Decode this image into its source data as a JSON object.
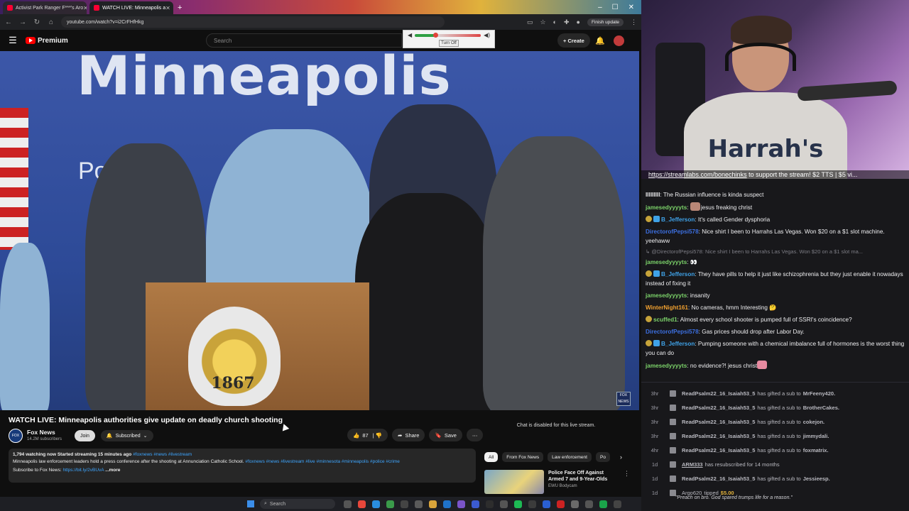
{
  "browser": {
    "tabs": [
      {
        "label": "Activist Park Ranger F***'s Aro",
        "active": false
      },
      {
        "label": "WATCH LIVE: Minneapolis a",
        "active": true
      }
    ],
    "url": "youtube.com/watch?v=i2CrFHfHkg",
    "finish_update": "Finish update"
  },
  "youtube": {
    "brand": "Premium",
    "search_placeholder": "Search",
    "create_label": "Create"
  },
  "volume_popup": {
    "turn_off_label": "Turn Off",
    "level": 0.3
  },
  "video": {
    "backdrop_word": "Minneapolis",
    "backdrop_sub": "Police",
    "seal_text": "1867",
    "seal_name": "MINNEAPOLIS",
    "seal_motto": "Serving Since",
    "network_bug": "FOX NEWS"
  },
  "watch": {
    "title": "WATCH LIVE: Minneapolis authorities give update on deadly church shooting",
    "channel_name": "Fox News",
    "channel_subs": "14.2M subscribers",
    "join_label": "Join",
    "subscribed_label": "Subscribed",
    "like_count": "87",
    "share_label": "Share",
    "save_label": "Save",
    "desc_stats": "1,794 watching now  Started streaming 15 minutes ago",
    "desc_hashtags_top": "#foxnews #news #livestream",
    "desc_line": "Minneapolis law enforcement leaders hold a press conference after the shooting at Annunciation Catholic School.",
    "desc_hashtags_line": "#foxnews #news #livestream #live #minnesota #minneapolis #police #crime",
    "desc_subscribe": "Subscribe to Fox News:",
    "desc_subscribe_link": "https://bit.ly/2vBUvA",
    "desc_more": "...more",
    "chat_disabled": "Chat is disabled for this live stream.",
    "chips": [
      "All",
      "From Fox News",
      "Law enforcement",
      "Po"
    ],
    "rec_title": "Police Face Off Against Armed 7 and 9-Year-Olds",
    "rec_channel": "EWU Bodycam"
  },
  "webcam": {
    "shirt_logo": "Harrah's",
    "ticker": "https://streamlabs.com/bonechinks",
    "ticker_rest": " to support the stream! $2 TTS | $5 vi..."
  },
  "chat": [
    {
      "user": "lllllllll",
      "color": "#efeff1",
      "badge": "",
      "emote": false,
      "text": "The Russian influence is kinda suspect"
    },
    {
      "user": "jamesedyyyyts",
      "color": "#7cd36a",
      "badge": "",
      "emote": true,
      "text": "jesus freaking christ"
    },
    {
      "user": "B_Jefferson",
      "color": "#3fa2e8",
      "badge": "gold-blue",
      "emote": false,
      "text": "It's called Gender dysphoria"
    },
    {
      "user": "DirectorofPepsi578",
      "color": "#3c6fe0",
      "badge": "",
      "emote": false,
      "text": "Nice shirt I been to Harrahs Las Vegas. Won $20 on a $1 slot machine. yeehaww"
    },
    {
      "reply": "@DirectorofPepsi578: Nice shirt I been to Harrahs Las Vegas. Won $20 on a $1 slot ma..."
    },
    {
      "user": "jamesedyyyyts",
      "color": "#7cd36a",
      "badge": "",
      "emote": false,
      "text": "👀"
    },
    {
      "user": "B_Jefferson",
      "color": "#3fa2e8",
      "badge": "gold-blue",
      "emote": false,
      "text": "They have pills to help it just like schizophrenia but they just enable it nowadays instead of fixing it"
    },
    {
      "user": "jamesedyyyyts",
      "color": "#7cd36a",
      "badge": "",
      "emote": false,
      "text": "insanity"
    },
    {
      "user": "WinterNight161",
      "color": "#f0a030",
      "badge": "",
      "emote": false,
      "text": "No cameras, hmm Interesting 🤔"
    },
    {
      "user": "scuffed1",
      "color": "#7cd36a",
      "badge": "gold",
      "emote": false,
      "text": "Almost every school shooter is pumped full of SSRI's coincidence?"
    },
    {
      "user": "DirectorofPepsi578",
      "color": "#3c6fe0",
      "badge": "",
      "emote": false,
      "text": "Gas prices should drop after Labor Day."
    },
    {
      "user": "B_Jefferson",
      "color": "#3fa2e8",
      "badge": "gold-blue",
      "emote": false,
      "text": "Pumping someone with a chemical imbalance full of hormones is the worst thing you can do"
    },
    {
      "user": "jamesedyyyyts",
      "color": "#7cd36a",
      "badge": "",
      "emote": false,
      "text": "no evidence?! jesus christ",
      "emote_after": true
    }
  ],
  "events": [
    {
      "time": "3hr",
      "name": "ReadPsalm22_16_Isaiah53_5",
      "action": "has gifted a sub to",
      "target": "MrFeeny420."
    },
    {
      "time": "3hr",
      "name": "ReadPsalm22_16_Isaiah53_5",
      "action": "has gifted a sub to",
      "target": "BrotherCakes."
    },
    {
      "time": "3hr",
      "name": "ReadPsalm22_16_Isaiah53_5",
      "action": "has gifted a sub to",
      "target": "cokejon."
    },
    {
      "time": "3hr",
      "name": "ReadPsalm22_16_Isaiah53_5",
      "action": "has gifted a sub to",
      "target": "jimmydali."
    },
    {
      "time": "4hr",
      "name": "ReadPsalm22_16_Isaiah53_5",
      "action": "has gifted a sub to",
      "target": "foxmatrix."
    },
    {
      "time": "1d",
      "name": "ARM333",
      "action": "has resubscribed for 14 months",
      "target": ""
    },
    {
      "time": "1d",
      "name": "ReadPsalm22_16_Isaiah53_5",
      "action": "has gifted a sub to",
      "target": "Jessieesp."
    },
    {
      "time": "1d",
      "name": "Argo620",
      "action": "tipped",
      "target": "$5.00",
      "quote": "\"Preach on bro. God spared trumps life for a reason.\""
    }
  ],
  "taskbar": {
    "search_label": "Search"
  }
}
